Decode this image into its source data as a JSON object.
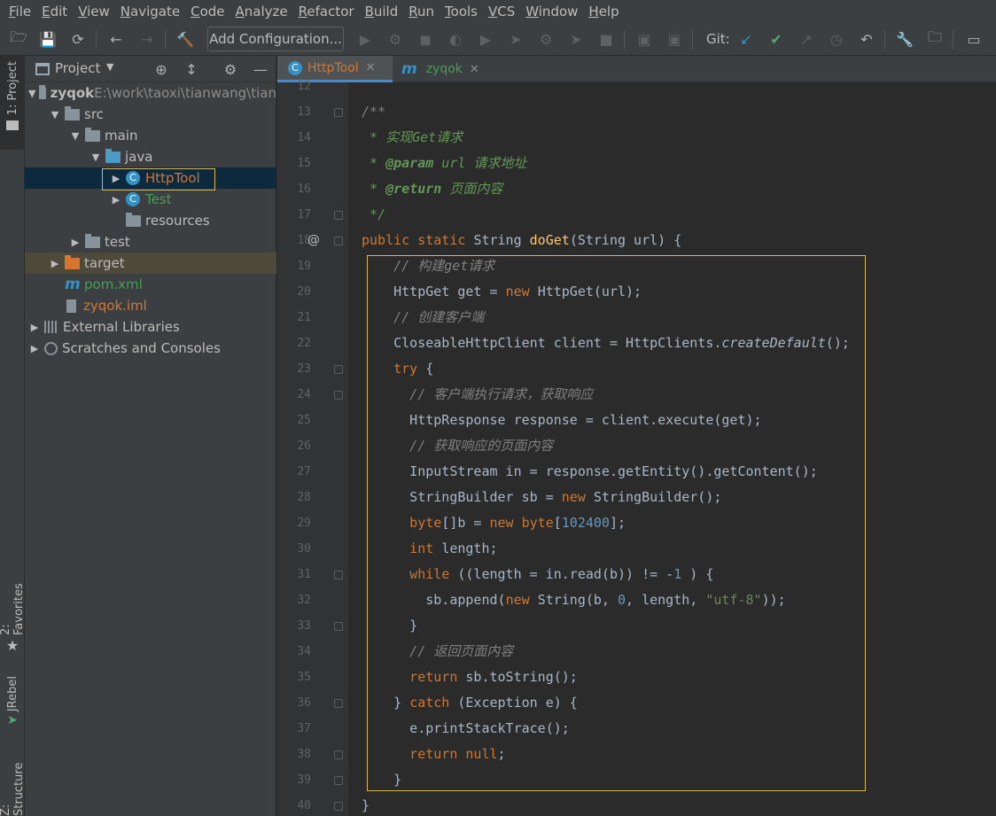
{
  "menu": [
    "File",
    "Edit",
    "View",
    "Navigate",
    "Code",
    "Analyze",
    "Refactor",
    "Build",
    "Run",
    "Tools",
    "VCS",
    "Window",
    "Help"
  ],
  "toolbar": {
    "add_configuration": "Add Configuration...",
    "git_label": "Git:"
  },
  "left_strip": {
    "project": "1: Project",
    "favorites": "2: Favorites",
    "jrebel": "JRebel",
    "structure": "Z: Structure"
  },
  "project_panel": {
    "title": "Project",
    "tree": [
      {
        "label": "zyqok",
        "suffix": " E:\\work\\taoxi\\tianwang\\tian",
        "icon": "folder",
        "depth": 0,
        "arrow": "down",
        "color": "#bbbbbb",
        "bold": true
      },
      {
        "label": "src",
        "icon": "folder",
        "depth": 1,
        "arrow": "down",
        "color": "#bbbbbb"
      },
      {
        "label": "main",
        "icon": "folder",
        "depth": 2,
        "arrow": "down",
        "color": "#bbbbbb"
      },
      {
        "label": "java",
        "icon": "folder-blue",
        "depth": 3,
        "arrow": "down",
        "color": "#bbbbbb"
      },
      {
        "label": "HttpTool",
        "icon": "class",
        "depth": 4,
        "arrow": "right",
        "color": "#d7752f",
        "selected": true
      },
      {
        "label": "Test",
        "icon": "class",
        "depth": 4,
        "arrow": "right",
        "color": "#499c54"
      },
      {
        "label": "resources",
        "icon": "folder",
        "depth": 4,
        "arrow": "",
        "color": "#bbbbbb"
      },
      {
        "label": "test",
        "icon": "folder",
        "depth": 2,
        "arrow": "right",
        "color": "#bbbbbb"
      },
      {
        "label": "target",
        "icon": "folder-orange",
        "depth": 1,
        "arrow": "right",
        "color": "#bbbbbb",
        "target": true
      },
      {
        "label": "pom.xml",
        "icon": "maven",
        "depth": 1,
        "arrow": "",
        "color": "#499c54"
      },
      {
        "label": "zyqok.iml",
        "icon": "file",
        "depth": 1,
        "arrow": "",
        "color": "#d7752f"
      },
      {
        "label": "External Libraries",
        "icon": "libs",
        "depth": 0,
        "arrow": "right",
        "color": "#bbbbbb"
      },
      {
        "label": "Scratches and Consoles",
        "icon": "scratch",
        "depth": 0,
        "arrow": "right",
        "color": "#bbbbbb"
      }
    ]
  },
  "tabs": [
    {
      "label": "HttpTool",
      "color": "#d7752f",
      "icon": "C"
    },
    {
      "label": "zyqok",
      "color": "#499c54",
      "icon": "m"
    }
  ],
  "editor": {
    "line_numbers": [
      "12",
      "13",
      "14",
      "15",
      "16",
      "17",
      "18",
      "19",
      "20",
      "21",
      "22",
      "23",
      "24",
      "25",
      "26",
      "27",
      "28",
      "29",
      "30",
      "31",
      "32",
      "33",
      "34",
      "35",
      "36",
      "37",
      "38",
      "39",
      "40"
    ],
    "gutter_marker": "@",
    "code": [
      [
        [
          "cm",
          ""
        ]
      ],
      [
        [
          "cm",
          "/**"
        ]
      ],
      [
        [
          "doc",
          " * 实现Get请求"
        ]
      ],
      [
        [
          "doc",
          " * "
        ],
        [
          "doctag",
          "@param"
        ],
        [
          "doc",
          " url 请求地址"
        ]
      ],
      [
        [
          "doc",
          " * "
        ],
        [
          "doctag",
          "@return"
        ],
        [
          "doc",
          " 页面内容"
        ]
      ],
      [
        [
          "doc",
          " */"
        ]
      ],
      [
        [
          "kw",
          "public static "
        ],
        [
          "",
          "String "
        ],
        [
          "fn",
          "doGet"
        ],
        [
          "",
          "(String url) {"
        ]
      ],
      [
        [
          "cm",
          "    // 构建get请求"
        ]
      ],
      [
        [
          "",
          "    HttpGet get = "
        ],
        [
          "kw",
          "new "
        ],
        [
          "",
          "HttpGet(url);"
        ]
      ],
      [
        [
          "cm",
          "    // 创建客户端"
        ]
      ],
      [
        [
          "",
          "    CloseableHttpClient client = HttpClients."
        ],
        [
          "it",
          "createDefault"
        ],
        [
          "",
          "();"
        ]
      ],
      [
        [
          "kw",
          "    try "
        ],
        [
          "",
          "{"
        ]
      ],
      [
        [
          "cm",
          "      // 客户端执行请求，获取响应"
        ]
      ],
      [
        [
          "",
          "      HttpResponse response = client.execute(get);"
        ]
      ],
      [
        [
          "cm",
          "      // 获取响应的页面内容"
        ]
      ],
      [
        [
          "",
          "      InputStream in = response.getEntity().getContent();"
        ]
      ],
      [
        [
          "",
          "      StringBuilder sb = "
        ],
        [
          "kw",
          "new "
        ],
        [
          "",
          "StringBuilder();"
        ]
      ],
      [
        [
          "kw",
          "      byte"
        ],
        [
          "",
          "[]b = "
        ],
        [
          "kw",
          "new byte"
        ],
        [
          "",
          "["
        ],
        [
          "num",
          "102400"
        ],
        [
          "",
          "];"
        ]
      ],
      [
        [
          "kw",
          "      int "
        ],
        [
          "",
          "length;"
        ]
      ],
      [
        [
          "kw",
          "      while "
        ],
        [
          "",
          "((length = in.read(b)) != -"
        ],
        [
          "num",
          "1"
        ],
        [
          "",
          " ) {"
        ]
      ],
      [
        [
          "",
          "        sb.append("
        ],
        [
          "kw",
          "new "
        ],
        [
          "",
          "String(b, "
        ],
        [
          "num",
          "0"
        ],
        [
          "",
          ", length, "
        ],
        [
          "str",
          "\"utf-8\""
        ],
        [
          "",
          "));"
        ]
      ],
      [
        [
          "",
          "      }"
        ]
      ],
      [
        [
          "cm",
          "      // 返回页面内容"
        ]
      ],
      [
        [
          "kw",
          "      return "
        ],
        [
          "",
          "sb.toString();"
        ]
      ],
      [
        [
          "",
          "    } "
        ],
        [
          "kw",
          "catch "
        ],
        [
          "",
          "(Exception e) {"
        ]
      ],
      [
        [
          "",
          "      e.printStackTrace();"
        ]
      ],
      [
        [
          "kw",
          "      return null"
        ],
        [
          "",
          ";"
        ]
      ],
      [
        [
          "",
          "    }"
        ]
      ],
      [
        [
          "",
          "}"
        ]
      ]
    ]
  }
}
